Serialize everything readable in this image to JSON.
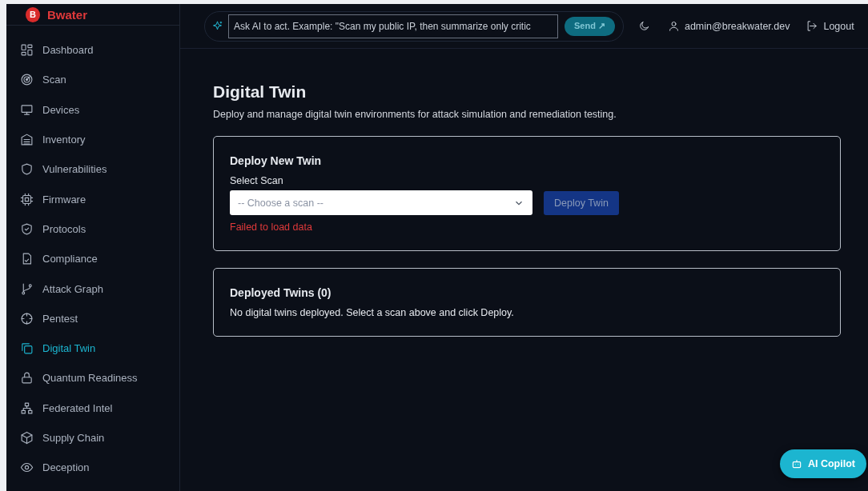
{
  "brand": {
    "badge": "B",
    "name": "Bwater"
  },
  "sidebar": {
    "items": [
      {
        "label": "Dashboard",
        "selected": false
      },
      {
        "label": "Scan",
        "selected": false
      },
      {
        "label": "Devices",
        "selected": false
      },
      {
        "label": "Inventory",
        "selected": false
      },
      {
        "label": "Vulnerabilities",
        "selected": false
      },
      {
        "label": "Firmware",
        "selected": false
      },
      {
        "label": "Protocols",
        "selected": false
      },
      {
        "label": "Compliance",
        "selected": false
      },
      {
        "label": "Attack Graph",
        "selected": false
      },
      {
        "label": "Pentest",
        "selected": false
      },
      {
        "label": "Digital Twin",
        "selected": true
      },
      {
        "label": "Quantum Readiness",
        "selected": false
      },
      {
        "label": "Federated Intel",
        "selected": false
      },
      {
        "label": "Supply Chain",
        "selected": false
      },
      {
        "label": "Deception",
        "selected": false
      }
    ]
  },
  "header": {
    "ai_input": {
      "value": "Ask AI to act. Example: \"Scan my public IP, then summarize only critic"
    },
    "send_button": "Send ↗",
    "user": "admin@breakwater.dev",
    "logout": "Logout"
  },
  "page": {
    "title": "Digital Twin",
    "subtitle": "Deploy and manage digital twin environments for attack simulation and remediation testing."
  },
  "deploy_card": {
    "title": "Deploy New Twin",
    "select_label": "Select Scan",
    "select": {
      "placeholder": "-- Choose a scan --"
    },
    "button": {
      "label": "Deploy Twin",
      "disabled": true
    },
    "error": "Failed to load data"
  },
  "deployed_card": {
    "title": "Deployed Twins (0)",
    "empty": "No digital twins deployed. Select a scan above and click Deploy."
  },
  "copilot_button": "AI Copilot"
}
